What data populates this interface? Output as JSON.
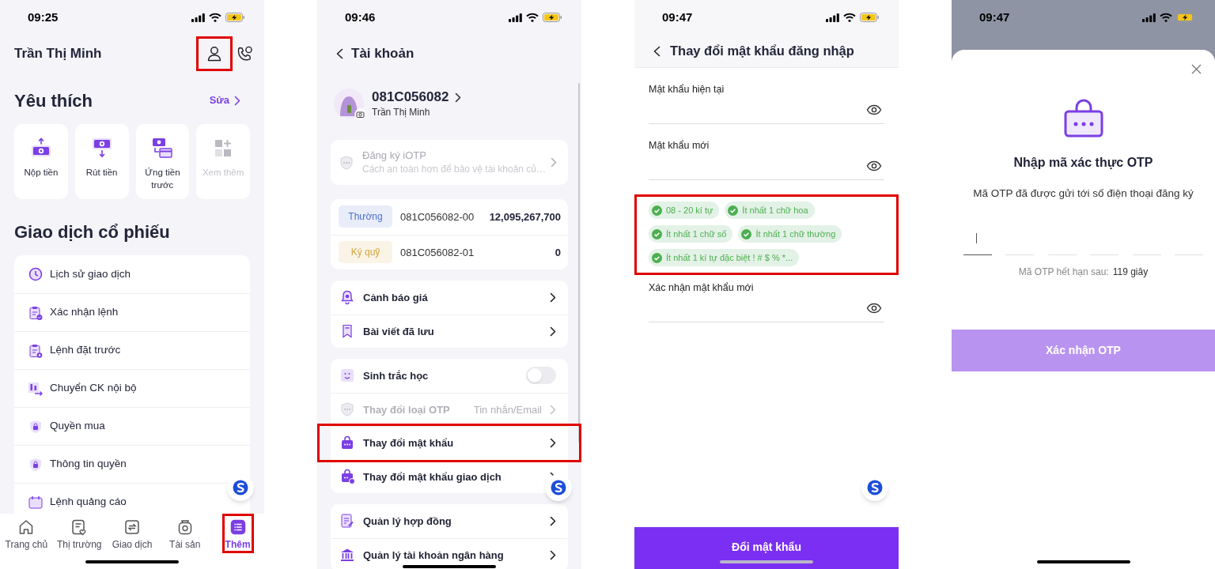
{
  "home_screen": {
    "status_bar": {
      "time": "09:25"
    },
    "user_name": "Trần Thị Minh",
    "profile_button": {
      "highlighted": true
    },
    "favorites": {
      "title": "Yêu thích",
      "edit_link": "Sửa",
      "items": [
        {
          "label": "Nộp tiền",
          "disabled": false
        },
        {
          "label": "Rút tiền",
          "disabled": false
        },
        {
          "label": "Ứng tiền trước",
          "disabled": false
        },
        {
          "label": "Xem thêm",
          "disabled": true
        }
      ]
    },
    "stock_trading": {
      "title": "Giao dịch cổ phiếu",
      "items": [
        {
          "label": "Lịch sử giao dịch"
        },
        {
          "label": "Xác nhận lệnh"
        },
        {
          "label": "Lệnh đặt trước"
        },
        {
          "label": "Chuyển CK nội bộ"
        },
        {
          "label": "Quyền mua"
        },
        {
          "label": "Thông tin quyền"
        },
        {
          "label": "Lệnh quảng cáo"
        }
      ]
    },
    "tab_bar": [
      {
        "label": "Trang chủ",
        "selected": false,
        "highlighted": false
      },
      {
        "label": "Thị trường",
        "selected": false,
        "highlighted": false
      },
      {
        "label": "Giao dịch",
        "selected": false,
        "highlighted": false
      },
      {
        "label": "Tài sản",
        "selected": false,
        "highlighted": false
      },
      {
        "label": "Thêm",
        "selected": true,
        "highlighted": true
      }
    ]
  },
  "account_screen": {
    "status_bar": {
      "time": "09:46"
    },
    "title": "Tài khoản",
    "profile": {
      "account_id": "081C056082",
      "name": "Trần Thị Minh"
    },
    "iotp_card": {
      "title": "Đăng ký iOTP",
      "subtitle": "Cách an toàn hơn để bảo vệ tài khoản củ…",
      "disabled": true
    },
    "sub_accounts": [
      {
        "type": "Thường",
        "color": "#4a6fd0",
        "number": "081C056082-00",
        "balance": "12,095,267,700"
      },
      {
        "type": "Ký quỹ",
        "color": "#d4a53b",
        "number": "081C056082-01",
        "balance": "0"
      }
    ],
    "menu_groups": [
      {
        "items": [
          {
            "kind": "link",
            "label": "Cảnh báo giá",
            "disabled": false,
            "highlighted": false
          },
          {
            "kind": "link",
            "label": "Bài viết đã lưu",
            "disabled": false,
            "highlighted": false
          }
        ]
      },
      {
        "items": [
          {
            "kind": "toggle",
            "label": "Sinh trắc học",
            "on": false,
            "disabled": false,
            "highlighted": false
          },
          {
            "kind": "value",
            "label": "Thay đổi loại OTP",
            "value": "Tin nhắn/Email",
            "disabled": true,
            "highlighted": false
          },
          {
            "kind": "link",
            "label": "Thay đổi mật khẩu",
            "disabled": false,
            "highlighted": true
          },
          {
            "kind": "link",
            "label": "Thay đổi mật khẩu giao dịch",
            "disabled": false,
            "highlighted": false
          }
        ]
      },
      {
        "items": [
          {
            "kind": "link",
            "label": "Quản lý hợp đồng",
            "disabled": false,
            "highlighted": false
          },
          {
            "kind": "link",
            "label": "Quản lý tài khoản ngân hàng",
            "disabled": false,
            "highlighted": false
          }
        ]
      }
    ]
  },
  "change_password_screen": {
    "status_bar": {
      "time": "09:47"
    },
    "title": "Thay đổi mật khẩu đăng nhập",
    "fields": [
      {
        "label": "Mật khẩu hiện tại"
      },
      {
        "label": "Mật khẩu mới",
        "rules": {
          "highlighted": true,
          "items": [
            {
              "label": "08 - 20 kí tự",
              "met": true
            },
            {
              "label": "Ít nhất 1 chữ hoa",
              "met": true
            },
            {
              "label": "Ít nhất 1 chữ số",
              "met": true
            },
            {
              "label": "Ít nhất 1 chữ thường",
              "met": true
            },
            {
              "label": "Ít nhất 1 kí tự đặc biệt ! # $ % *...",
              "met": true
            }
          ]
        }
      },
      {
        "label": "Xác nhận mật khẩu mới"
      }
    ],
    "submit_button": {
      "label": "Đổi mật khẩu",
      "disabled": false
    }
  },
  "otp_screen": {
    "status_bar": {
      "time": "09:47"
    },
    "dialog": {
      "title": "Nhập mã xác thực OTP",
      "message": "Mã OTP đã được gửi tới số điện thoại đăng ký",
      "code_slots": [
        {
          "focused": true
        },
        {
          "focused": false
        },
        {
          "focused": false
        },
        {
          "focused": false
        },
        {
          "focused": false
        },
        {
          "focused": false
        }
      ],
      "expiry_label": "Mã OTP hết hạn sau:",
      "expiry_value": "119 giây",
      "confirm_button": {
        "label": "Xác nhận OTP",
        "disabled": true
      }
    }
  }
}
